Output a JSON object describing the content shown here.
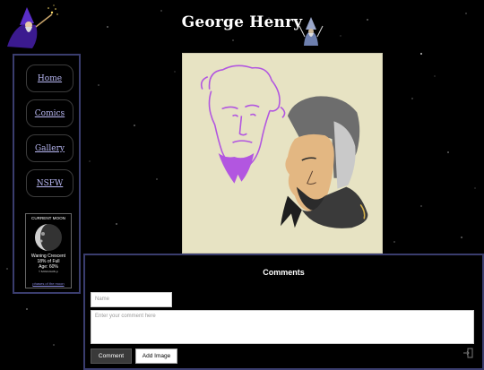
{
  "header": {
    "title": "George Henry"
  },
  "nav": {
    "items": [
      {
        "label": "Home"
      },
      {
        "label": "Comics"
      },
      {
        "label": "Gallery"
      },
      {
        "label": "NSFW"
      }
    ]
  },
  "moon": {
    "heading": "CURRENT MOON",
    "phase": "Waning Crescent",
    "full_pct": "18% of Full",
    "age": "Age: 60%",
    "credit": "© BAREKAEWE.jp",
    "link": "phases of the moon"
  },
  "comments": {
    "title": "Comments",
    "name_placeholder": "Name",
    "comment_placeholder": "Enter your comment here",
    "submit_label": "Comment",
    "add_image_label": "Add Image"
  },
  "colors": {
    "background": "#000000",
    "frame_border": "#3a3d6e",
    "nav_link": "#b9b8f4",
    "art_background": "#e7e3c3",
    "sketch_purple": "#b256e0"
  },
  "icons": [
    "wizard-left-icon",
    "wizard-right-icon",
    "moon-icon",
    "login-icon"
  ]
}
